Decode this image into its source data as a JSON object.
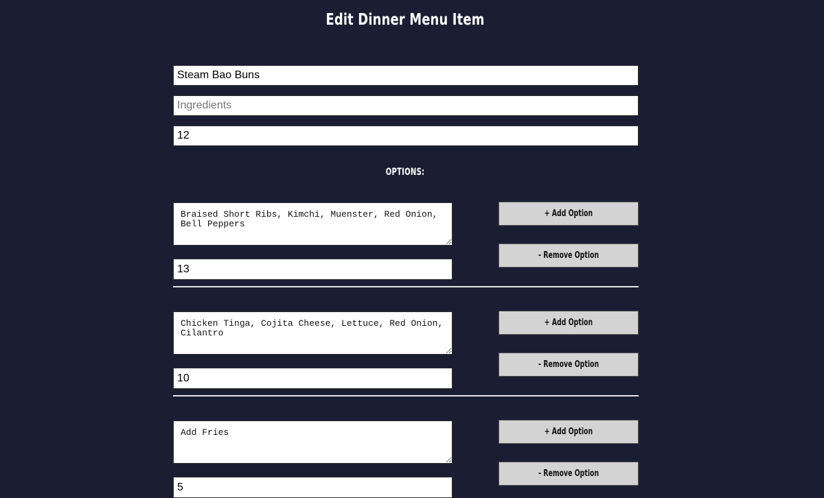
{
  "page": {
    "title": "Edit Dinner Menu Item"
  },
  "item": {
    "name_value": "Steam Bao Buns",
    "ingredients_placeholder": "Ingredients",
    "ingredients_value": "",
    "price_value": "12"
  },
  "options_label": "OPTIONS:",
  "options": [
    {
      "description": "Braised Short Ribs, Kimchi, Muenster, Red Onion, Bell Peppers",
      "price": "13",
      "add_label": "+ Add Option",
      "remove_label": "- Remove Option"
    },
    {
      "description": "Chicken Tinga, Cojita Cheese, Lettuce, Red Onion, Cilantro",
      "price": "10",
      "add_label": "+ Add Option",
      "remove_label": "- Remove Option"
    },
    {
      "description": "Add Fries",
      "price": "5",
      "add_label": "+ Add Option",
      "remove_label": "- Remove Option"
    }
  ],
  "colors": {
    "background": "#1b1e33",
    "button": "#d3d3d3",
    "text": "#ffffff"
  }
}
